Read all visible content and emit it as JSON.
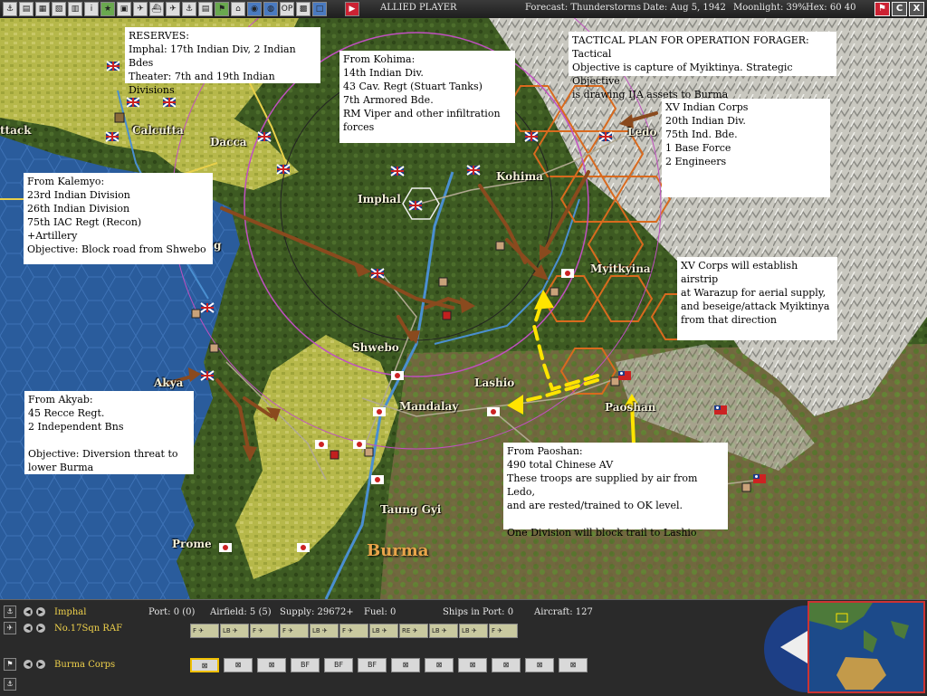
{
  "topbar": {
    "player_label": "ALLIED PLAYER",
    "forecast": "Forecast: Thunderstorms",
    "date": "Date: Aug 5, 1942",
    "moonlight": "Moonlight: 39%",
    "hex": "Hex: 60 40",
    "minimize_label": "",
    "close_label": "C",
    "exit_label": "X"
  },
  "map": {
    "places": {
      "calcutta": "Calcutta",
      "dacca": "Dacca",
      "imphal": "Imphal",
      "kohima": "Kohima",
      "ledo": "Ledo",
      "myitkyina": "Myitkyina",
      "shwebo": "Shwebo",
      "mandalay": "Mandalay",
      "lashio": "Lashio",
      "paoshan": "Paoshan",
      "akyab": "Akya",
      "taunggyi": "Taung Gyi",
      "prome": "Prome",
      "attack_cut": "ttack",
      "chittagong_cut": "g"
    },
    "region_label": "Burma"
  },
  "notes": {
    "reserves": "RESERVES:\nImphal:  17th Indian Div, 2 Indian Bdes\nTheater:  7th and 19th Indian Divisions",
    "kohima": "From Kohima:\n14th Indian Div.\n43 Cav. Regt (Stuart Tanks)\n7th Armored Bde.\nRM Viper and other infiltration\nforces",
    "tactical": "TACTICAL PLAN FOR OPERATION FORAGER:  Tactical\nObjective is capture of Myiktinya.  Strategic Objective\nis drawing IJA assets to Burma",
    "xv_corps": "XV Indian Corps\n20th Indian Div.\n75th Ind. Bde.\n1 Base Force\n2 Engineers",
    "kalemyo": "From Kalemyo:\n23rd Indian Division\n26th Indian Division\n75th IAC Regt (Recon)\n+Artillery\nObjective:  Block road from Shwebo",
    "airstrip": "XV Corps will establish airstrip\nat Warazup for aerial supply,\nand beseige/attack Myiktinya\nfrom that direction",
    "akyab": "From Akyab:\n45 Recce Regt.\n2 Independent Bns\n\nObjective:  Diversion threat to\nlower Burma",
    "paoshan": "From Paoshan:\n490 total Chinese AV\nThese troops are supplied by air from Ledo,\nand are rested/trained to OK level.\n\nOne Division will block trail to Lashio"
  },
  "panel": {
    "base_name": "Imphal",
    "port": "Port: 0 (0)",
    "airfield": "Airfield: 5 (5)",
    "supply": "Supply: 29672+",
    "fuel": "Fuel: 0",
    "ships": "Ships in Port: 0",
    "aircraft": "Aircraft: 127",
    "squadron": "No.17Sqn RAF",
    "corps": "Burma Corps",
    "air_units": [
      "F",
      "LB",
      "F",
      "F",
      "LB",
      "F",
      "LB",
      "RE",
      "LB",
      "LB",
      "F"
    ],
    "ground_units": [
      "",
      "",
      "",
      "BF",
      "BF",
      "BF",
      "",
      "",
      "",
      "",
      "",
      ""
    ]
  },
  "colors": {
    "arrow_brown": "#8a4a1e",
    "arrow_yellow": "#ffe400",
    "base_name_yellow": "#f1d34b"
  }
}
